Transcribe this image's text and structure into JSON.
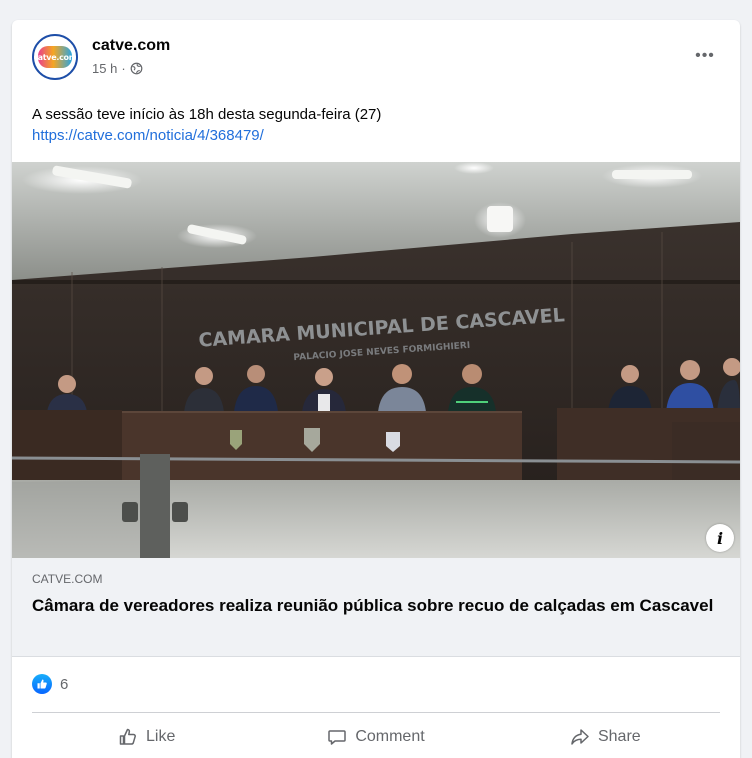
{
  "post": {
    "page_name": "catve.com",
    "avatar_text": "catve.com",
    "time": "15 h",
    "separator": "·",
    "privacy_icon": "globe-icon",
    "more_label": "•••",
    "text": "A sessão teve início às 18h desta segunda-feira (27)",
    "link": "https://catve.com/noticia/4/368479/"
  },
  "media": {
    "wall_sign": "CAMARA MUNICIPAL DE CASCAVEL",
    "wall_subsign": "PALACIO JOSE NEVES FORMIGHIERI",
    "info_label": "i"
  },
  "preview": {
    "domain": "CATVE.COM",
    "headline": "Câmara de vereadores realiza reunião pública sobre recuo de calçadas em Cascavel"
  },
  "reactions": {
    "icon": "like-reaction-icon",
    "count": "6"
  },
  "actions": {
    "like": "Like",
    "comment": "Comment",
    "share": "Share"
  },
  "colors": {
    "link": "#216fdb",
    "like_blue": "#0866ff",
    "muted": "#65676b"
  }
}
